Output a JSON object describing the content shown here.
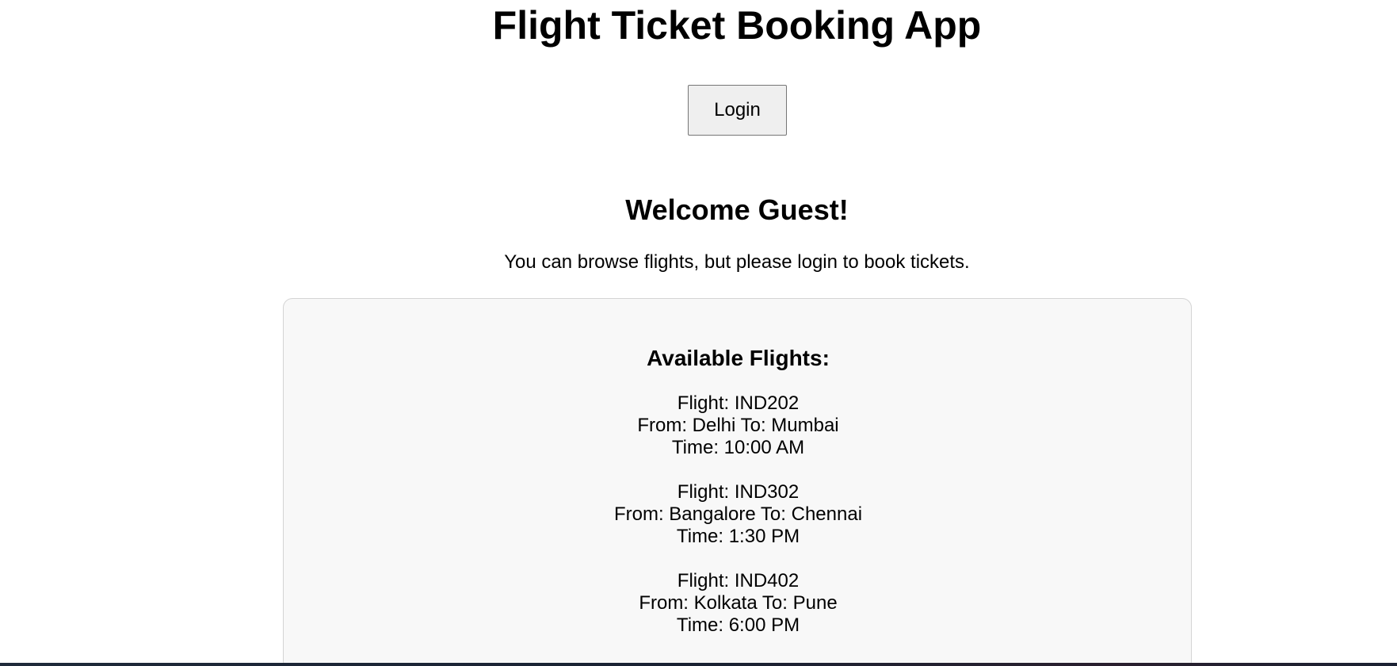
{
  "app": {
    "title": "Flight Ticket Booking App"
  },
  "header": {
    "login_label": "Login"
  },
  "welcome": {
    "heading": "Welcome Guest!",
    "message": "You can browse flights, but please login to book tickets."
  },
  "flights": {
    "heading": "Available Flights:",
    "items": [
      {
        "flight_line": "Flight: IND202",
        "route_line": "From: Delhi To: Mumbai",
        "time_line": "Time: 10:00 AM"
      },
      {
        "flight_line": "Flight: IND302",
        "route_line": "From: Bangalore To: Chennai",
        "time_line": "Time: 1:30 PM"
      },
      {
        "flight_line": "Flight: IND402",
        "route_line": "From: Kolkata To: Pune",
        "time_line": "Time: 6:00 PM"
      }
    ]
  },
  "colors": {
    "panel_background": "#f8f8f8",
    "panel_border": "#d4d4d4",
    "button_background": "#efefef",
    "button_border": "#767676"
  }
}
